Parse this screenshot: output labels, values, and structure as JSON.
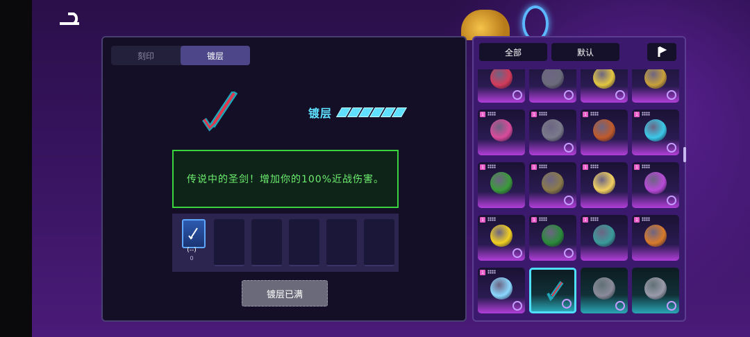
{
  "tabs": [
    {
      "label": "刻印",
      "active": false
    },
    {
      "label": "镀层",
      "active": true
    }
  ],
  "coating": {
    "title": "镀层",
    "level_filled": 6,
    "description": "传说中的圣剑！增加你的100%近战伤害。"
  },
  "slots": {
    "first_mark": "(--)",
    "first_count": "0",
    "empty_count": 5
  },
  "full_button": "镀层已满",
  "filters": {
    "all": "全部",
    "default": "默认"
  },
  "colors": {
    "accent_cyan": "#4fe0ff",
    "desc_green": "#6df06f",
    "rarity_purple": "#e85cc8"
  },
  "items": [
    {
      "icon": "target-shield-icon",
      "rarity": "",
      "badge": "swirl-icon"
    },
    {
      "icon": "microphone-icon",
      "rarity": "",
      "badge": "chart-icon"
    },
    {
      "icon": "phone-icon",
      "rarity": "",
      "badge": "gear-icon"
    },
    {
      "icon": "trophy-icon",
      "rarity": "",
      "badge": "t-icon"
    },
    {
      "icon": "2077-patch-icon",
      "rarity": "1",
      "badge": ""
    },
    {
      "icon": "anvil-icon",
      "rarity": "1",
      "badge": "target-icon"
    },
    {
      "icon": "spartan-helmet-icon",
      "rarity": "1",
      "badge": ""
    },
    {
      "icon": "bug-icon",
      "rarity": "1",
      "badge": "wing-icon"
    },
    {
      "icon": "green-glove-icon",
      "rarity": "1",
      "badge": ""
    },
    {
      "icon": "backpack-icon",
      "rarity": "1",
      "badge": "cup-icon"
    },
    {
      "icon": "ice-cream-icon",
      "rarity": "1",
      "badge": ""
    },
    {
      "icon": "potion-icon",
      "rarity": "1",
      "badge": "swirl-icon"
    },
    {
      "icon": "chick-icon",
      "rarity": "1",
      "badge": "swirl-icon"
    },
    {
      "icon": "pizza-icon",
      "rarity": "1",
      "badge": "fish-icon"
    },
    {
      "icon": "watch-icon",
      "rarity": "1",
      "badge": ""
    },
    {
      "icon": "lion-icon",
      "rarity": "1",
      "badge": ""
    },
    {
      "icon": "ghost-flame-icon",
      "rarity": "1",
      "badge": "target-icon"
    },
    {
      "icon": "sword-icon",
      "rarity": "",
      "badge": "wing-icon"
    },
    {
      "icon": "backpack-gray-icon",
      "rarity": "",
      "badge": "wing-icon"
    },
    {
      "icon": "knight-helmet-icon",
      "rarity": "",
      "badge": "ii-icon"
    }
  ]
}
